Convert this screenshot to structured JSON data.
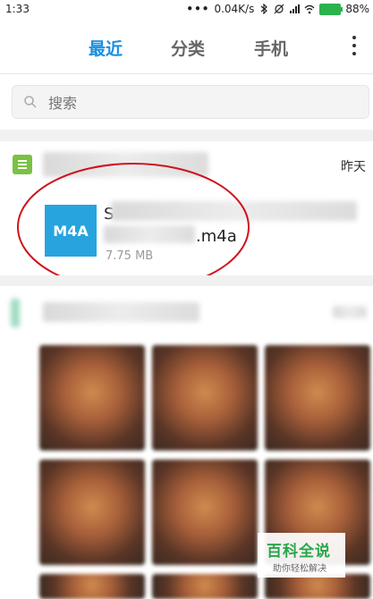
{
  "status_bar": {
    "time": "1:33",
    "network_speed": "0.04K/s",
    "battery_percent": "88%"
  },
  "tabs": [
    {
      "label": "最近",
      "active": true
    },
    {
      "label": "分类",
      "active": false
    },
    {
      "label": "手机",
      "active": false
    }
  ],
  "search": {
    "placeholder": "搜索"
  },
  "group": {
    "time_label": "昨天"
  },
  "file": {
    "type_label": "M4A",
    "name_start": "S",
    "name_end": ".m4a",
    "size": "7.75 MB"
  },
  "watermark": {
    "title": "百科全说",
    "subtitle": "助你轻松解决"
  },
  "colors": {
    "accent": "#1a8fe0",
    "file_thumb": "#27a4dd",
    "doc_icon": "#7ac144",
    "highlight": "#d0121b",
    "watermark": "#2aa54a"
  }
}
